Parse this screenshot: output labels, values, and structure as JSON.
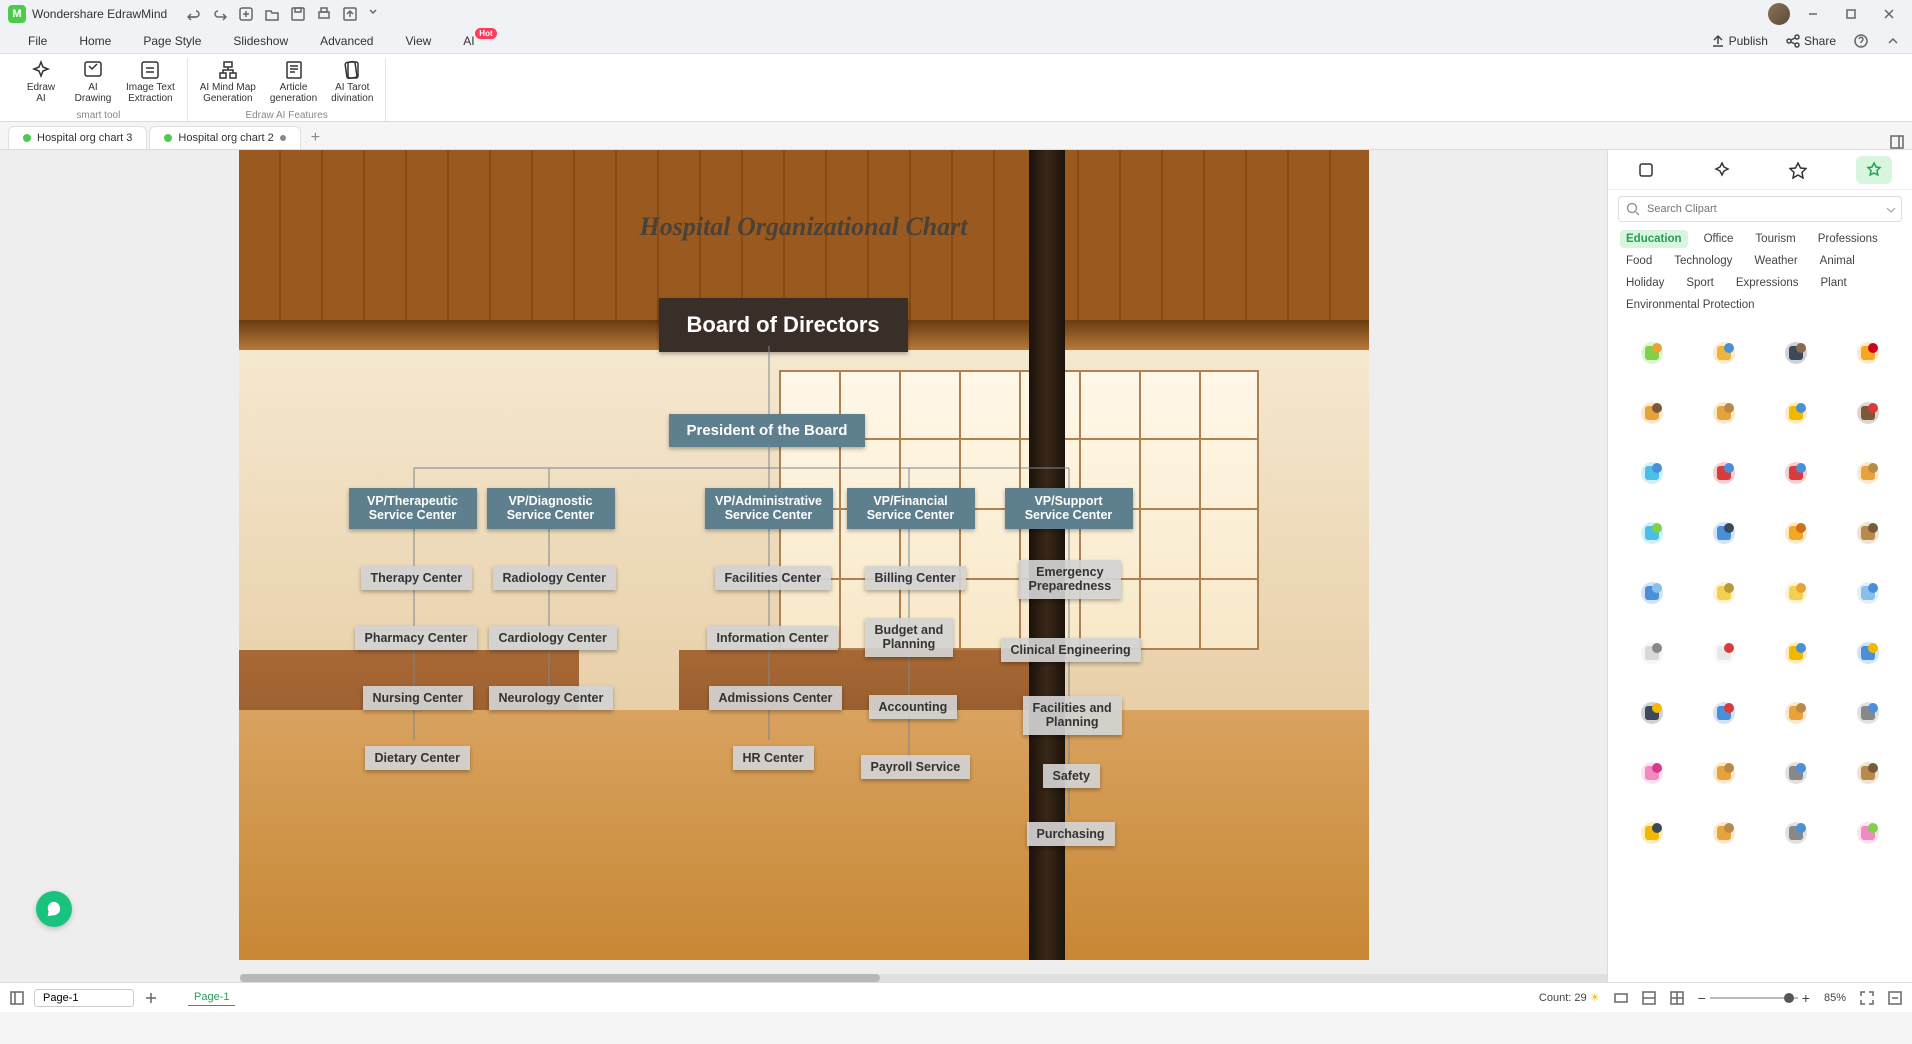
{
  "app_name": "Wondershare EdrawMind",
  "menus": [
    "File",
    "Home",
    "Page Style",
    "Slideshow",
    "Advanced",
    "View",
    "AI"
  ],
  "ai_badge": "Hot",
  "menubar_right": {
    "publish": "Publish",
    "share": "Share"
  },
  "ribbon": {
    "g1": {
      "items": [
        "Edraw\nAI",
        "AI\nDrawing",
        "Image Text\nExtraction"
      ],
      "label": "smart tool"
    },
    "g2": {
      "items": [
        "AI Mind Map\nGeneration",
        "Article\ngeneration",
        "AI Tarot\ndivination"
      ],
      "label": "Edraw AI Features"
    }
  },
  "doc_tabs": [
    {
      "name": "Hospital org chart 3"
    },
    {
      "name": "Hospital org chart 2",
      "dirty": true
    }
  ],
  "right_panel": {
    "search_placeholder": "Search Clipart",
    "categories": [
      "Education",
      "Office",
      "Tourism",
      "Professions",
      "Food",
      "Technology",
      "Weather",
      "Animal",
      "Holiday",
      "Sport",
      "Expressions",
      "Plant",
      "Environmental Protection"
    ],
    "active_cat": "Education",
    "items": [
      "desk-lamp",
      "ruler-set",
      "blackboard",
      "pencil",
      "backpack",
      "open-book",
      "building-blocks",
      "chemistry",
      "water-drop",
      "rubiks-cube",
      "magnet",
      "school-house",
      "globe",
      "telescope",
      "basketball",
      "guitar",
      "molecule",
      "magnifier",
      "light-bulb",
      "eraser",
      "watch",
      "compass",
      "paint-bucket",
      "medal",
      "graduation-cap",
      "school-building",
      "diploma",
      "drafting-compass",
      "palette",
      "hourglass",
      "microscope",
      "bookshelf",
      "school-bus",
      "cardboard-box",
      "clip",
      "dancer"
    ]
  },
  "chart": {
    "title": "Hospital Organizational Chart",
    "board": "Board of Directors",
    "president": "President of the Board",
    "vps": [
      "VP/Therapeutic\nService Center",
      "VP/Diagnostic\nService Center",
      "VP/Administrative\nService Center",
      "VP/Financial\nService Center",
      "VP/Support\nService Center"
    ],
    "col1": [
      "Therapy Center",
      "Pharmacy Center",
      "Nursing Center",
      "Dietary Center"
    ],
    "col2": [
      "Radiology Center",
      "Cardiology Center",
      "Neurology Center"
    ],
    "col3": [
      "Facilities Center",
      "Information Center",
      "Admissions Center",
      "HR Center"
    ],
    "col4": [
      "Billing Center",
      "Budget and\nPlanning",
      "Accounting",
      "Payroll Service"
    ],
    "col5": [
      "Emergency\nPreparedness",
      "Clinical Engineering",
      "Facilities and\nPlanning",
      "Safety",
      "Purchasing"
    ]
  },
  "statusbar": {
    "page_select": "Page-1",
    "page_current": "Page-1",
    "count_label": "Count:",
    "count_value": "29",
    "zoom_pct": "85%"
  }
}
